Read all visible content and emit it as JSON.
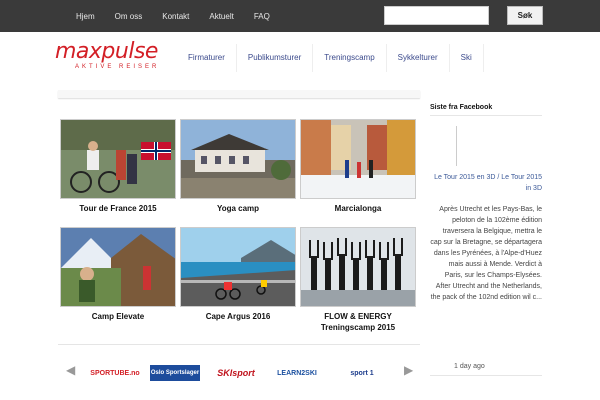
{
  "topnav": [
    "Hjem",
    "Om oss",
    "Kontakt",
    "Aktuelt",
    "FAQ"
  ],
  "search": {
    "button": "Søk",
    "value": ""
  },
  "logo": {
    "main": "maxpulse",
    "sub": "AKTIVE REISER"
  },
  "mainnav": [
    "Firmaturer",
    "Publikumsturer",
    "Treningscamp",
    "Sykkelturer",
    "Ski"
  ],
  "tiles": [
    {
      "caption": "Tour de France 2015"
    },
    {
      "caption": "Yoga camp"
    },
    {
      "caption": "Marcialonga"
    },
    {
      "caption": "Camp Elevate"
    },
    {
      "caption": "Cape Argus 2016"
    },
    {
      "caption": "FLOW & ENERGY Treningscamp 2015"
    }
  ],
  "sponsors": [
    "SPORTUBE.no",
    "Oslo Sportslager",
    "SKIsport",
    "LEARN2SKI",
    "sport 1"
  ],
  "sidebar": {
    "title": "Siste fra Facebook",
    "link": "Le Tour 2015 en 3D / Le Tour 2015 in 3D",
    "text": "Après Utrecht et les Pays-Bas, le peloton de la 102ème édition traversera la Belgique, mettra le cap sur la Bretagne, se départagera dans les Pyrénées, à l'Alpe-d'Huez mais aussi à Mende. Verdict à Paris, sur les Champs-Elysées. After Utrecht and the Netherlands, the pack of the 102nd edition wil c...",
    "ago": "1 day ago"
  },
  "colors": {
    "brand": "#d31f26",
    "topbar": "#3a3a3a",
    "nav_text": "#3b4a8c",
    "fb_link": "#3b5998"
  }
}
